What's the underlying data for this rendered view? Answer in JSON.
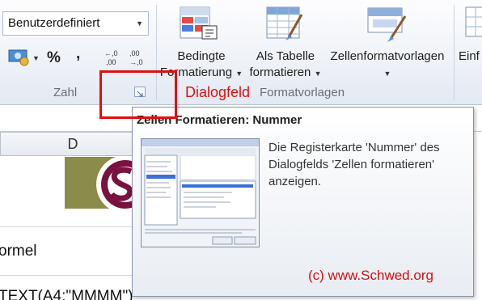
{
  "ribbon": {
    "format_combo_value": "Benutzerdefiniert",
    "currency_symbol": "€",
    "percent": "%",
    "comma": ",",
    "increase_decimal": ",00→,0",
    "decrease_decimal": ",00→,0",
    "group_number_label": "Zahl",
    "conditional_formatting": {
      "line1": "Bedingte",
      "line2": "Formatierung"
    },
    "format_as_table": {
      "line1": "Als Tabelle",
      "line2": "formatieren"
    },
    "cell_styles": {
      "line1": "Zellenformatvorlagen"
    },
    "insert_cut": "Einf",
    "group_styles_label": "Formatvorlagen"
  },
  "annotation": {
    "dialog_label": "Dialogfeld"
  },
  "sheet": {
    "column_header": "D",
    "row_text_1": "ormel",
    "row_text_2": "TEXT(A4;\"MMMM\")"
  },
  "tooltip": {
    "title": "Zellen Formatieren: Nummer",
    "body": "Die Registerkarte 'Nummer' des Dialogfelds 'Zellen formatieren' anzeigen.",
    "copyright": "(c) www.Schwed.org"
  },
  "colors": {
    "annotation_red": "#e01010",
    "logo_olive": "#8b8b4a",
    "logo_maroon": "#7a1140"
  }
}
